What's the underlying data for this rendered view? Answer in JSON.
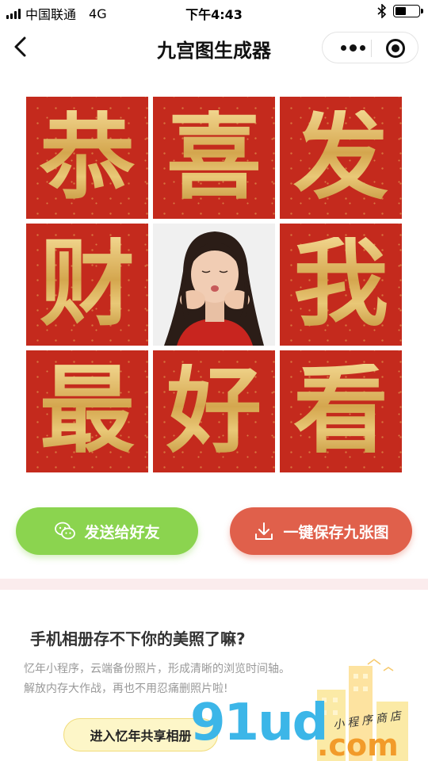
{
  "status_bar": {
    "carrier": "中国联通",
    "network": "4G",
    "time": "下午4:43"
  },
  "navbar": {
    "title": "九宫图生成器",
    "back_icon": "chevron-left-icon",
    "more_icon": "more-dots-icon",
    "close_icon": "target-circle-icon"
  },
  "grid": {
    "cells": [
      "恭",
      "喜",
      "发",
      "财",
      "",
      "我",
      "最",
      "好",
      "看"
    ],
    "tile_color": "#c42a1d",
    "glyph_color": "#d9b45e"
  },
  "actions": {
    "share_label": "发送给好友",
    "share_icon": "wechat-icon",
    "share_color": "#8bd44f",
    "save_label": "一键保存九张图",
    "save_icon": "download-icon",
    "save_color": "#e0604b"
  },
  "promo": {
    "title": "手机相册存不下你的美照了嘛?",
    "line1": "忆年小程序，云端备份照片，形成清晰的浏览时间轴。",
    "line2": "解放内存大作战，再也不用忍痛删照片啦!",
    "button_label": "进入忆年共享相册"
  },
  "watermark": {
    "main": "91ud",
    "suffix": ".com",
    "tagline": "小程序商店"
  }
}
